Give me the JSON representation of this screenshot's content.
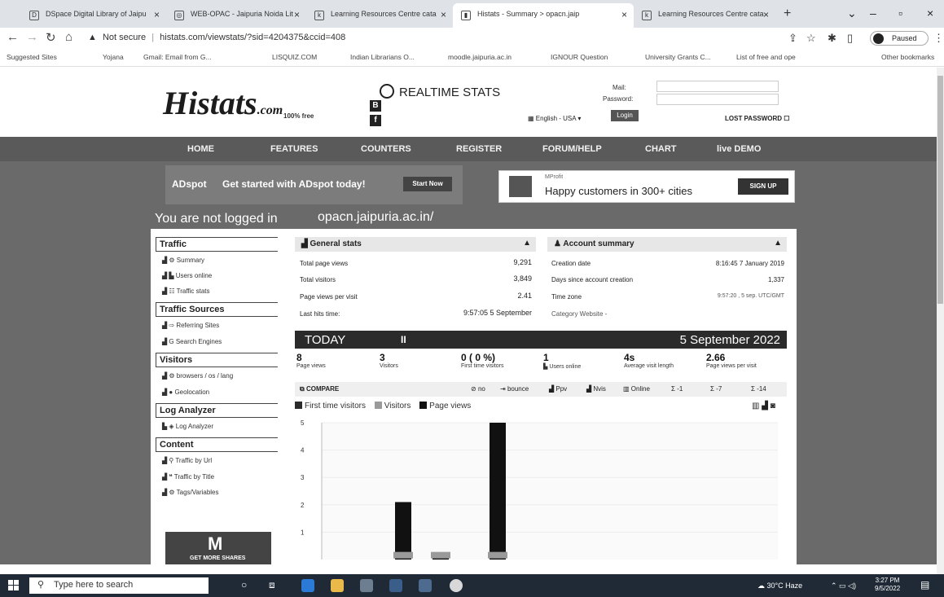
{
  "browser": {
    "tabs": [
      {
        "label": "DSpace Digital Library of Jaipu"
      },
      {
        "label": "WEB-OPAC - Jaipuria Noida Lit"
      },
      {
        "label": "Learning Resources Centre cata"
      },
      {
        "label": "Histats - Summary > opacn.jaip"
      },
      {
        "label": "Learning Resources Centre cata"
      }
    ],
    "new_tab": "+",
    "address": {
      "warning": "Not secure",
      "url": "histats.com/viewstats/?sid=4204375&ccid=408"
    },
    "profile_status": "Paused",
    "bookmarks": [
      {
        "label": "Suggested Sites"
      },
      {
        "label": "Yojana"
      },
      {
        "label": "Gmail: Email from G..."
      },
      {
        "label": "LISQUIZ.COM"
      },
      {
        "label": "Indian Librarians O..."
      },
      {
        "label": "moodle.jaipuria.ac.in"
      },
      {
        "label": "IGNOUR Question"
      },
      {
        "label": "University Grants C..."
      },
      {
        "label": "List of free and ope"
      },
      {
        "label": "Other bookmarks"
      }
    ]
  },
  "header": {
    "logo": "Histats",
    "logo_suffix": ".com",
    "logo_tag": "100% free",
    "realtime": "REALTIME STATS",
    "mail_label": "Mail:",
    "password_label": "Password:",
    "language": "English - USA",
    "login": "Login",
    "lost_password": "LOST PASSWORD"
  },
  "nav": [
    "HOME",
    "FEATURES",
    "COUNTERS",
    "REGISTER",
    "FORUM/HELP",
    "CHART",
    "live DEMO"
  ],
  "ads": {
    "adspot_brand": "ADspot",
    "adspot_text": "Get started with ADspot today!",
    "adspot_button": "Start Now",
    "mpro_small": "MProfit",
    "mpro_text": "Happy customers in 300+ cities",
    "mpro_button": "SIGN UP"
  },
  "status": {
    "not_logged": "You are not logged in",
    "site": "opacn.jaipuria.ac.in/"
  },
  "sidebar": {
    "traffic": "Traffic",
    "traffic_items": [
      "Summary",
      "Users online",
      "Traffic stats"
    ],
    "traffic_sources": "Traffic Sources",
    "sources_items": [
      "Referring Sites",
      "Search Engines"
    ],
    "visitors": "Visitors",
    "visitors_items": [
      "browsers / os / lang",
      "Geolocation"
    ],
    "log_analyzer": "Log Analyzer",
    "log_items": [
      "Log Analyzer"
    ],
    "content": "Content",
    "content_items": [
      "Traffic by Url",
      "Traffic by Title",
      "Tags/Variables"
    ],
    "promo_letter": "M",
    "promo_text": "GET MORE SHARES"
  },
  "general_stats": {
    "title": "General stats",
    "rows": [
      {
        "label": "Total page views",
        "value": "9,291"
      },
      {
        "label": "Total visitors",
        "value": "3,849"
      },
      {
        "label": "Page views per visit",
        "value": "2.41"
      },
      {
        "label": "Last hits time:",
        "value": "9:57:05 5 September"
      }
    ]
  },
  "account_summary": {
    "title": "Account summary",
    "rows": [
      {
        "label": "Creation date",
        "value": "8:16:45 7 January 2019"
      },
      {
        "label": "Days since account creation",
        "value": "1,337"
      },
      {
        "label": "Time zone",
        "value": "9:57:20 , 5 sep. UTC/GMT"
      },
      {
        "label": "Category Website -",
        "value": ""
      }
    ]
  },
  "today": {
    "label": "TODAY",
    "pause": "II",
    "date": "5 September 2022",
    "stats": [
      {
        "value": "8",
        "label": "Page views"
      },
      {
        "value": "3",
        "label": "Visitors"
      },
      {
        "value": "0 ( 0 %)",
        "label": "First time visitors"
      },
      {
        "value": "1",
        "label": "Users online"
      },
      {
        "value": "4s",
        "label": "Average visit length"
      },
      {
        "value": "2.66",
        "label": "Page views per visit"
      }
    ]
  },
  "compare": {
    "label": "COMPARE",
    "options": [
      "no",
      "bounce",
      "Ppv",
      "Nvis",
      "Online",
      "-1",
      "-7",
      "-14"
    ]
  },
  "legend": [
    {
      "name": "First time visitors",
      "color": "#2a2a2a"
    },
    {
      "name": "Visitors",
      "color": "#9a9a9a"
    },
    {
      "name": "Page views",
      "color": "#111111"
    }
  ],
  "chart_data": {
    "type": "bar",
    "ylim": [
      0,
      5
    ],
    "yticks": [
      1,
      2,
      3,
      4,
      5
    ],
    "series": [
      {
        "name": "Visitors",
        "values": [
          0.1,
          0.1,
          0.1
        ]
      },
      {
        "name": "Page views",
        "values": [
          2.1,
          0.2,
          5.0
        ]
      }
    ]
  },
  "taskbar": {
    "search_placeholder": "Type here to search",
    "weather": "30°C Haze",
    "time": "3:27 PM",
    "date": "9/5/2022"
  }
}
